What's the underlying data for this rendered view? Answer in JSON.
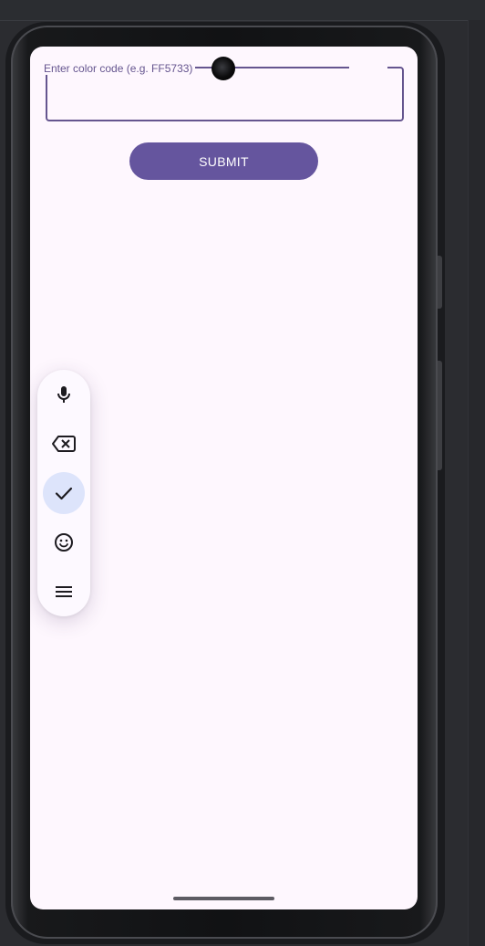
{
  "color_input": {
    "label": "Enter color code (e.g. FF5733)",
    "value": ""
  },
  "submit": {
    "label": "SUBMIT"
  },
  "floating_toolbar": {
    "items": [
      {
        "icon": "microphone-icon"
      },
      {
        "icon": "backspace-icon"
      },
      {
        "icon": "check-icon",
        "active": true
      },
      {
        "icon": "emoji-icon"
      },
      {
        "icon": "menu-icon"
      }
    ]
  },
  "colors": {
    "accent": "#65559e",
    "outline": "#65558f",
    "surface": "#fef7fe",
    "active_chip": "#dde4fb"
  }
}
